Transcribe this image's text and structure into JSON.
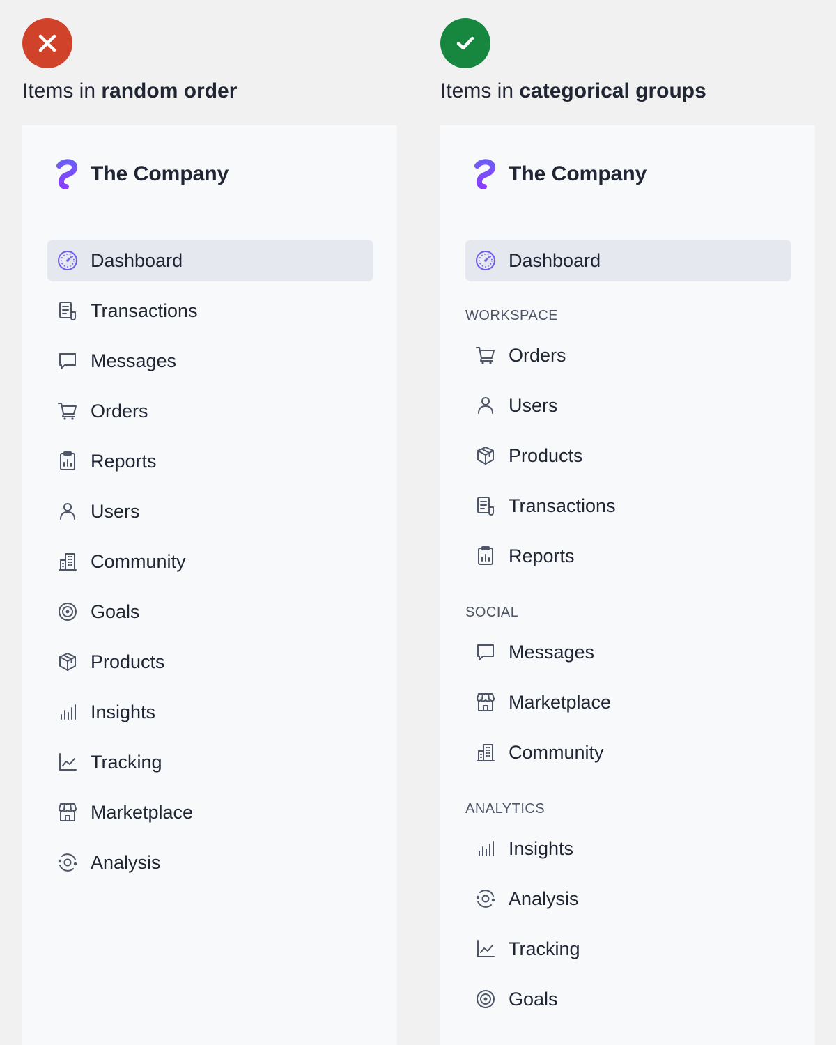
{
  "colors": {
    "bad_badge": "#d0432a",
    "good_badge": "#17873f",
    "logo_gradient_top": "#6d5df4",
    "logo_gradient_bottom": "#8b3dff",
    "icon_stroke": "#4d5566",
    "active_bg": "#e5e8ef"
  },
  "left": {
    "badge_icon": "x-icon",
    "heading_prefix": "Items in ",
    "heading_bold": "random order",
    "brand": "The Company",
    "items": [
      {
        "label": "Dashboard",
        "icon": "dashboard-icon",
        "active": true
      },
      {
        "label": "Transactions",
        "icon": "transactions-icon"
      },
      {
        "label": "Messages",
        "icon": "messages-icon"
      },
      {
        "label": "Orders",
        "icon": "cart-icon"
      },
      {
        "label": "Reports",
        "icon": "reports-icon"
      },
      {
        "label": "Users",
        "icon": "user-icon"
      },
      {
        "label": "Community",
        "icon": "building-icon"
      },
      {
        "label": "Goals",
        "icon": "target-icon"
      },
      {
        "label": "Products",
        "icon": "package-icon"
      },
      {
        "label": "Insights",
        "icon": "bars-icon"
      },
      {
        "label": "Tracking",
        "icon": "line-chart-icon"
      },
      {
        "label": "Marketplace",
        "icon": "store-icon"
      },
      {
        "label": "Analysis",
        "icon": "analysis-icon"
      }
    ]
  },
  "right": {
    "badge_icon": "check-icon",
    "heading_prefix": "Items in ",
    "heading_bold": "categorical groups",
    "brand": "The Company",
    "dashboard": {
      "label": "Dashboard",
      "icon": "dashboard-icon",
      "active": true
    },
    "sections": [
      {
        "title": "WORKSPACE",
        "items": [
          {
            "label": "Orders",
            "icon": "cart-icon"
          },
          {
            "label": "Users",
            "icon": "user-icon"
          },
          {
            "label": "Products",
            "icon": "package-icon"
          },
          {
            "label": "Transactions",
            "icon": "transactions-icon"
          },
          {
            "label": "Reports",
            "icon": "reports-icon"
          }
        ]
      },
      {
        "title": "SOCIAL",
        "items": [
          {
            "label": "Messages",
            "icon": "messages-icon"
          },
          {
            "label": "Marketplace",
            "icon": "store-icon"
          },
          {
            "label": "Community",
            "icon": "building-icon"
          }
        ]
      },
      {
        "title": "ANALYTICS",
        "items": [
          {
            "label": "Insights",
            "icon": "bars-icon"
          },
          {
            "label": "Analysis",
            "icon": "analysis-icon"
          },
          {
            "label": "Tracking",
            "icon": "line-chart-icon"
          },
          {
            "label": "Goals",
            "icon": "target-icon"
          }
        ]
      }
    ]
  }
}
